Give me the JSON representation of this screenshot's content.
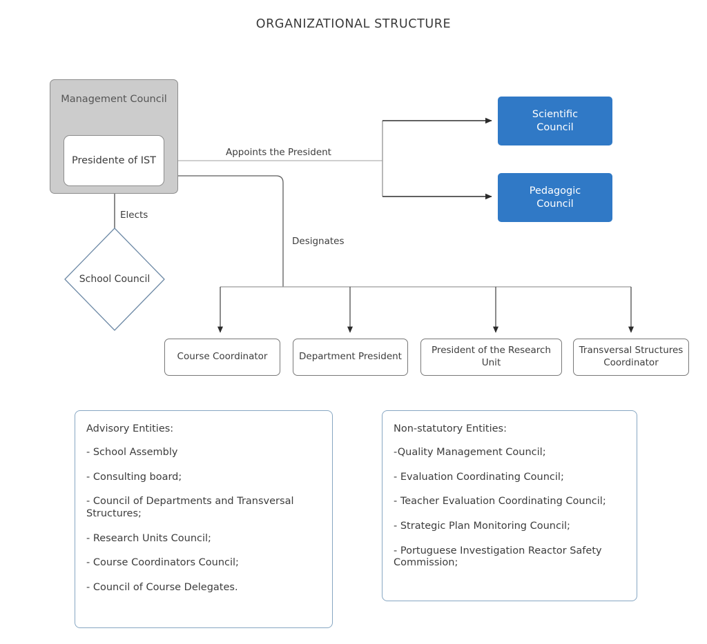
{
  "title": "ORGANIZATIONAL STRUCTURE",
  "nodes": {
    "management_council": "Management Council",
    "president_ist": "Presidente of IST",
    "scientific_council": "Scientific\nCouncil",
    "pedagogic_council": "Pedagogic\nCouncil",
    "school_council": "School Council",
    "course_coordinator": "Course Coordinator",
    "department_president": "Department President",
    "research_unit_president": "President of the Research Unit",
    "transversal_coordinator": "Transversal Structures Coordinator"
  },
  "edge_labels": {
    "appoints": "Appoints the President",
    "designates": "Designates",
    "elects": "Elects"
  },
  "panels": {
    "advisory": {
      "heading": "Advisory Entities:",
      "items": [
        "- School Assembly",
        "- Consulting board;",
        "- Council of Departments and Transversal Structures;",
        "- Research Units Council;",
        "- Course Coordinators Council;",
        "- Council of Course Delegates."
      ]
    },
    "nonstatutory": {
      "heading": "Non-statutory Entities:",
      "items": [
        "-Quality Management Council;",
        "- Evaluation Coordinating Council;",
        "- Teacher Evaluation Coordinating Council;",
        "- Strategic Plan Monitoring Council;",
        "- Portuguese Investigation Reactor Safety Commission;"
      ]
    }
  },
  "colors": {
    "council_blue": "#3079c6",
    "management_gray": "#cccccc",
    "management_border": "#8c8c8c",
    "diamond_border": "#6e8aa6",
    "panel_border": "#86a6c2",
    "edge_dark": "#333333",
    "edge_light": "#bfbfbf",
    "background": "#ffffff"
  }
}
